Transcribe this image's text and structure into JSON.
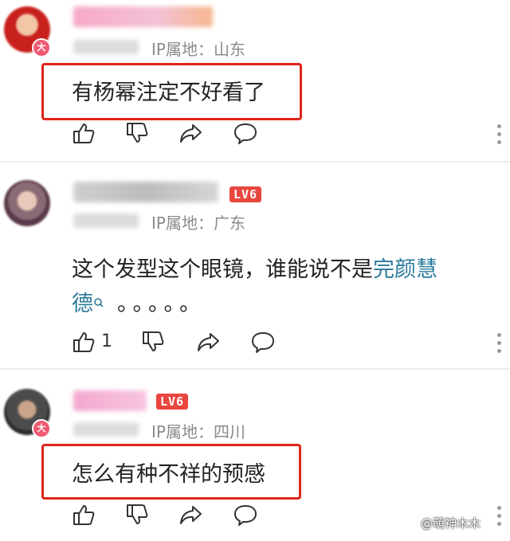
{
  "comments": [
    {
      "ip_label": "IP属地：山东",
      "text": "有杨幂注定不好看了",
      "badge": "大",
      "like_count": ""
    },
    {
      "ip_label": "IP属地：广东",
      "text_line1_prefix": "这个发型这个眼镜，谁能说不是",
      "text_line1_link": "完颜慧",
      "text_line2_link": "德",
      "text_line2_suffix": "。。。。。",
      "level_badge": "LV6",
      "like_count": "1"
    },
    {
      "ip_label": "IP属地：四川",
      "text": "怎么有种不祥的预感",
      "badge": "大",
      "level_badge": "LV6",
      "like_count": ""
    }
  ],
  "watermark": "@萌神木木",
  "icons": [
    "thumbs-up-icon",
    "thumbs-down-icon",
    "share-icon",
    "comment-icon",
    "more-icon",
    "search-icon"
  ]
}
